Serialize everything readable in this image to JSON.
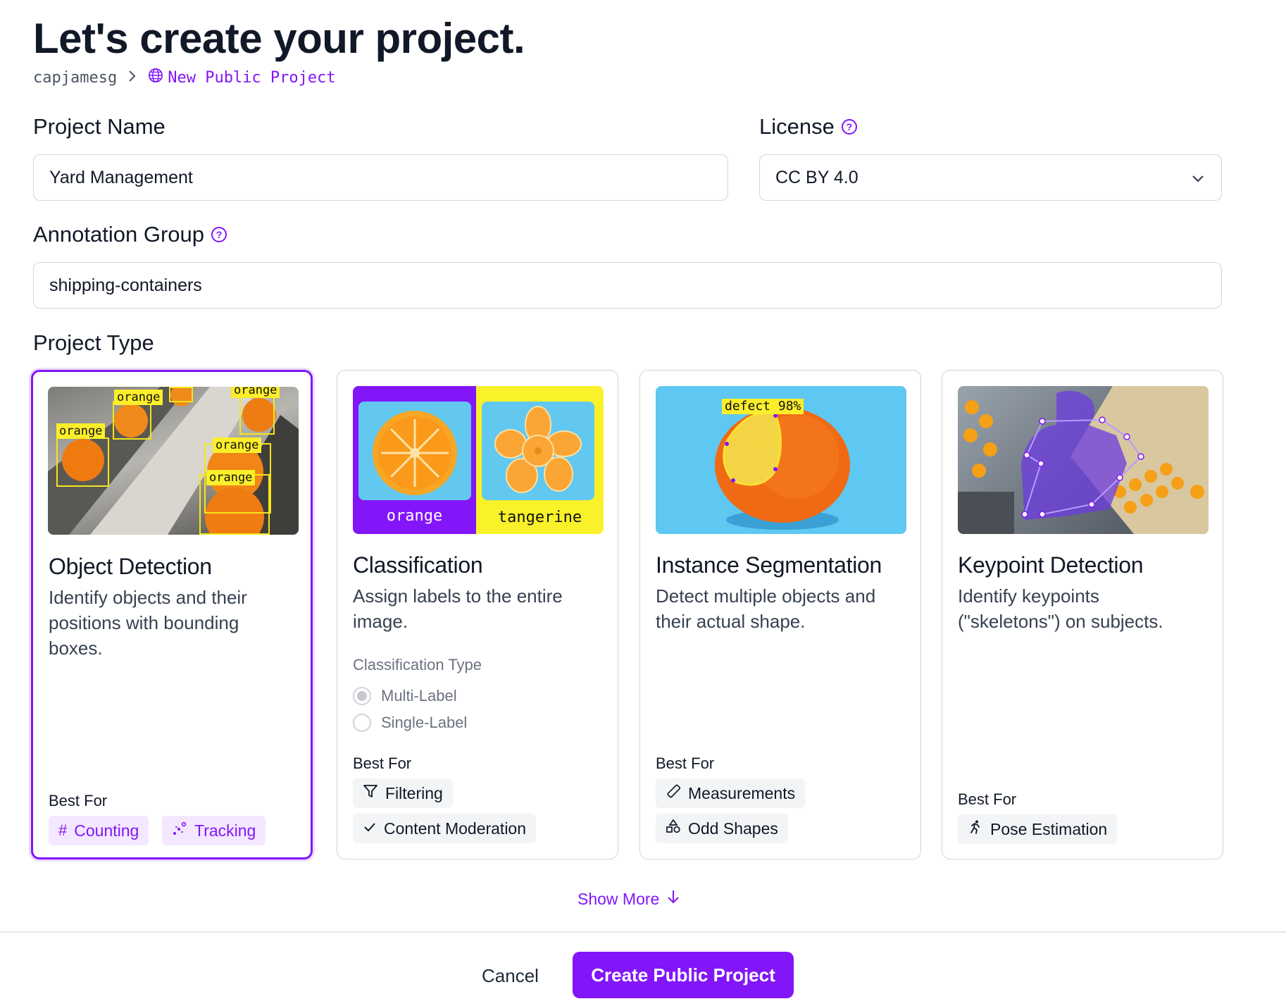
{
  "header": {
    "title": "Let's create your project.",
    "breadcrumb": {
      "user": "capjamesg",
      "separator": ">",
      "current": "New Public Project"
    }
  },
  "form": {
    "project_name": {
      "label": "Project Name",
      "value": "Yard Management"
    },
    "license": {
      "label": "License",
      "value": "CC BY 4.0"
    },
    "annotation_group": {
      "label": "Annotation Group",
      "value": "shipping-containers"
    },
    "project_type_label": "Project Type"
  },
  "cards": [
    {
      "title": "Object Detection",
      "description": "Identify objects and their positions with bounding boxes.",
      "best_for_label": "Best For",
      "tags": [
        {
          "icon": "hash-icon",
          "label": "Counting"
        },
        {
          "icon": "tracking-icon",
          "label": "Tracking"
        }
      ],
      "image_labels": [
        "orange",
        "orange",
        "orange",
        "orange",
        "orange"
      ]
    },
    {
      "title": "Classification",
      "description": "Assign labels to the entire image.",
      "classification_type_label": "Classification Type",
      "options": [
        "Multi-Label",
        "Single-Label"
      ],
      "best_for_label": "Best For",
      "tags": [
        {
          "icon": "filter-icon",
          "label": "Filtering"
        },
        {
          "icon": "check-icon",
          "label": "Content Moderation"
        }
      ],
      "image_labels": [
        "orange",
        "tangerine"
      ]
    },
    {
      "title": "Instance Segmentation",
      "description": "Detect multiple objects and their actual shape.",
      "best_for_label": "Best For",
      "tags": [
        {
          "icon": "ruler-icon",
          "label": "Measurements"
        },
        {
          "icon": "shapes-icon",
          "label": "Odd Shapes"
        }
      ],
      "image_labels": [
        "defect 98%"
      ]
    },
    {
      "title": "Keypoint Detection",
      "description": "Identify keypoints (\"skeletons\") on subjects.",
      "best_for_label": "Best For",
      "tags": [
        {
          "icon": "running-person-icon",
          "label": "Pose Estimation"
        }
      ]
    }
  ],
  "actions": {
    "show_more": "Show More",
    "cancel": "Cancel",
    "create": "Create Public Project"
  },
  "colors": {
    "accent": "#8315f9",
    "border": "#d1d5db",
    "tag_bg": "#f3f4f6",
    "tag_purple_bg": "#f3e8ff"
  }
}
